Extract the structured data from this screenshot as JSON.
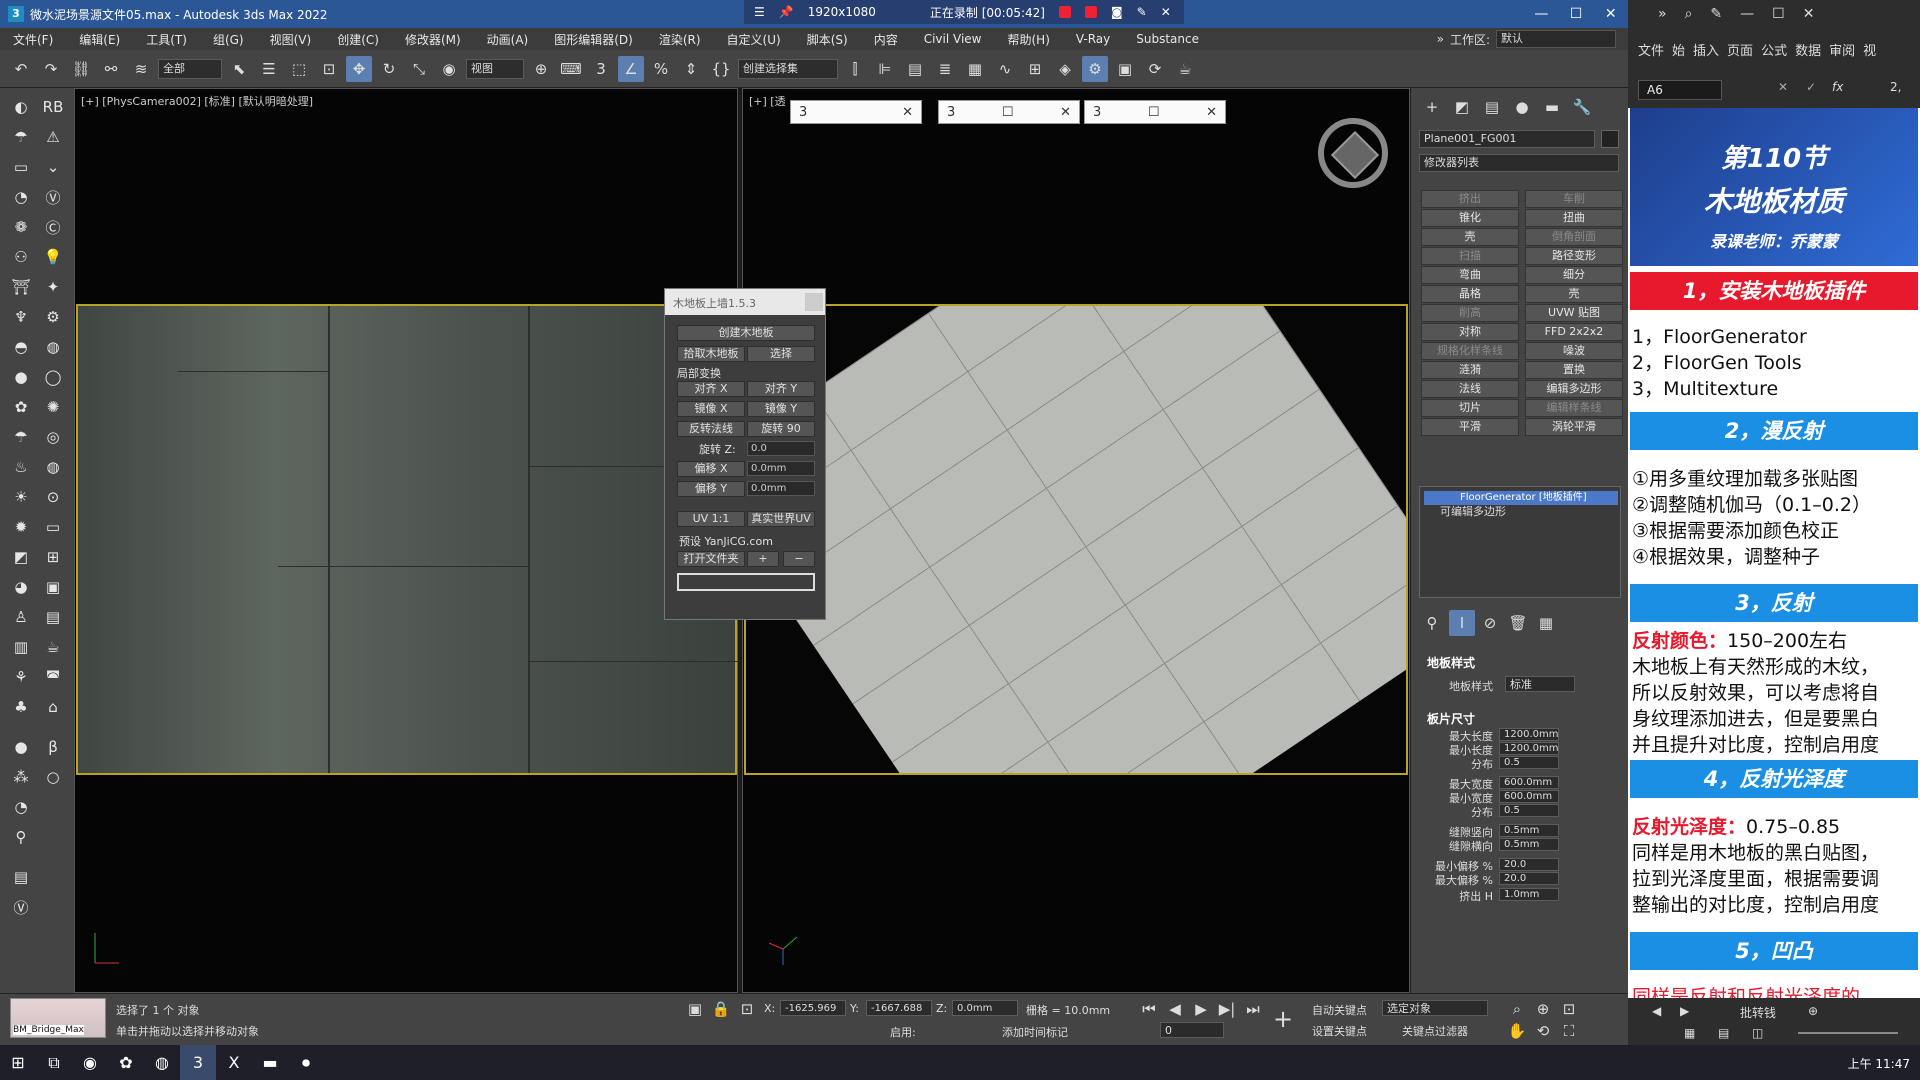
{
  "window": {
    "title": "微水泥场景源文件05.max - Autodesk 3ds Max 2022",
    "app_icon": "3"
  },
  "recording": {
    "resolution": "1920x1080",
    "status": "正在录制 [00:05:42]"
  },
  "menu": [
    "文件(F)",
    "编辑(E)",
    "工具(T)",
    "组(G)",
    "视图(V)",
    "创建(C)",
    "修改器(M)",
    "动画(A)",
    "图形编辑器(D)",
    "渲染(R)",
    "自定义(U)",
    "脚本(S)",
    "内容",
    "Civil View",
    "帮助(H)",
    "V-Ray",
    "Substance"
  ],
  "workspace": {
    "label": "工作区:",
    "value": "默认"
  },
  "toolbar": {
    "filter": "全部",
    "ref_coord": "视图",
    "selection_set": "创建选择集"
  },
  "viewport_left": {
    "label": "[+] [PhysCamera002] [标准] [默认明暗处理]"
  },
  "viewport_right": {
    "label": "[+] [透"
  },
  "tabs": [
    {
      "label": "3",
      "title": ""
    },
    {
      "label": "3",
      "title": ""
    },
    {
      "label": "3",
      "title": ""
    }
  ],
  "plugin": {
    "title": "木地板上墙1.5.3",
    "create": "创建木地板",
    "pick": "拾取木地板",
    "select": "选择",
    "local_transform": "局部变换",
    "align_x": "对齐 X",
    "align_y": "对齐 Y",
    "mirror_x": "镜像 X",
    "mirror_y": "镜像 Y",
    "flip_normal": "反转法线",
    "rotate_90": "旋转 90",
    "rotate_z_label": "旋转 Z:",
    "rotate_z_value": "0.0",
    "offset_x_label": "偏移 X",
    "offset_x_value": "0.0mm",
    "offset_y_label": "偏移 Y",
    "offset_y_value": "0.0mm",
    "uv_11": "UV 1:1",
    "real_world_uv": "真实世界UV",
    "preset_label": "预设 YanJiCG.com",
    "open_folder": "打开文件夹",
    "plus": "+",
    "minus": "−"
  },
  "command_panel": {
    "object_name": "Plane001_FG001",
    "modifier_list": "修改器列表",
    "modifier_buttons": [
      {
        "label": "挤出",
        "dim": true
      },
      {
        "label": "车削",
        "dim": true
      },
      {
        "label": "锥化",
        "dim": false
      },
      {
        "label": "扭曲",
        "dim": false
      },
      {
        "label": "壳",
        "dim": false
      },
      {
        "label": "倒角剖面",
        "dim": true
      },
      {
        "label": "扫描",
        "dim": true
      },
      {
        "label": "路径变形",
        "dim": false
      },
      {
        "label": "弯曲",
        "dim": false
      },
      {
        "label": "细分",
        "dim": false
      },
      {
        "label": "晶格",
        "dim": false
      },
      {
        "label": "壳",
        "dim": false
      },
      {
        "label": "削高",
        "dim": true
      },
      {
        "label": "UVW 贴图",
        "dim": false
      },
      {
        "label": "对称",
        "dim": false
      },
      {
        "label": "FFD 2x2x2",
        "dim": false
      },
      {
        "label": "规格化样条线",
        "dim": true
      },
      {
        "label": "噪波",
        "dim": false
      },
      {
        "label": "涟漪",
        "dim": false
      },
      {
        "label": "置换",
        "dim": false
      },
      {
        "label": "法线",
        "dim": false
      },
      {
        "label": "编辑多边形",
        "dim": false
      },
      {
        "label": "切片",
        "dim": false
      },
      {
        "label": "编辑样条线",
        "dim": true
      },
      {
        "label": "平滑",
        "dim": false
      },
      {
        "label": "涡轮平滑",
        "dim": false
      }
    ],
    "stack": [
      {
        "label": "FloorGenerator [地板插件]",
        "selected": true
      },
      {
        "label": "可编辑多边形",
        "selected": false
      }
    ],
    "rollout_style": "地板样式",
    "style_label": "地板样式",
    "style_value": "标准",
    "rollout_size": "板片尺寸",
    "params": [
      {
        "label": "最大长度",
        "value": "1200.0mm"
      },
      {
        "label": "最小长度",
        "value": "1200.0mm"
      },
      {
        "label": "分布",
        "value": "0.5"
      },
      {
        "label": "最大宽度",
        "value": "600.0mm"
      },
      {
        "label": "最小宽度",
        "value": "600.0mm"
      },
      {
        "label": "分布",
        "value": "0.5"
      },
      {
        "label": "缝隙竖向",
        "value": "0.5mm"
      },
      {
        "label": "缝隙横向",
        "value": "0.5mm"
      },
      {
        "label": "最小偏移 %",
        "value": "20.0"
      },
      {
        "label": "最大偏移 %",
        "value": "20.0"
      },
      {
        "label": "挤出 H",
        "value": "1.0mm"
      }
    ]
  },
  "status": {
    "material_name": "BM_Bridge_Max",
    "selected": "选择了 1 个 对象",
    "hint": "单击并拖动以选择并移动对象",
    "x_label": "X:",
    "x_value": "-1625.969",
    "y_label": "Y:",
    "y_value": "-1667.688",
    "z_label": "Z:",
    "z_value": "0.0mm",
    "grid": "栅格 = 10.0mm",
    "auto_key": "自动关键点",
    "selected_obj": "选定对象",
    "set_key": "设置关键点",
    "key_filter": "关键点过滤器",
    "enable": "启用:",
    "add_time_tag": "添加时间标记",
    "frame": "0"
  },
  "excel": {
    "tabs": [
      "文件",
      "始",
      "插入",
      "页面",
      "公式",
      "数据",
      "审阅",
      "视"
    ],
    "cell_ref": "A6",
    "formula_extra": "2,",
    "sheet_label": "批转钱"
  },
  "slide": {
    "lesson": "第110节",
    "topic": "木地板材质",
    "teacher": "录课老师：乔蒙蒙",
    "sections": [
      {
        "title": "1，安装木地板插件",
        "color": "#e8192c"
      },
      {
        "title": "2，漫反射",
        "color": "#1a8fe3"
      },
      {
        "title": "3，反射",
        "color": "#1a8fe3"
      },
      {
        "title": "4，反射光泽度",
        "color": "#1a8fe3"
      },
      {
        "title": "5，凹凸",
        "color": "#1a8fe3"
      }
    ],
    "install_items": [
      "1，FloorGenerator",
      "2，FloorGen Tools",
      "3，Multitexture"
    ],
    "diffuse_items": [
      "①用多重纹理加载多张贴图",
      "②调整随机伽马（0.1–0.2）",
      "③根据需要添加颜色校正",
      "④根据效果，调整种子"
    ],
    "reflect_label": "反射颜色：",
    "reflect_value": "150–200左右",
    "reflect_text": [
      "木地板上有天然形成的木纹，",
      "所以反射效果，可以考虑将自",
      "身纹理添加进去，但是要黑白",
      "并且提升对比度，控制启用度"
    ],
    "gloss_label": "反射光泽度：",
    "gloss_value": "0.75–0.85",
    "gloss_text": [
      "同样是用木地板的黑白贴图，",
      "拉到光泽度里面，根据需要调",
      "整输出的对比度，控制启用度"
    ],
    "bump_partial": "同样是反射和反射光泽度的"
  },
  "taskbar": {
    "time": "上午 11:47"
  },
  "colors": {
    "accent": "#2b5797",
    "selection": "#b9a225"
  }
}
